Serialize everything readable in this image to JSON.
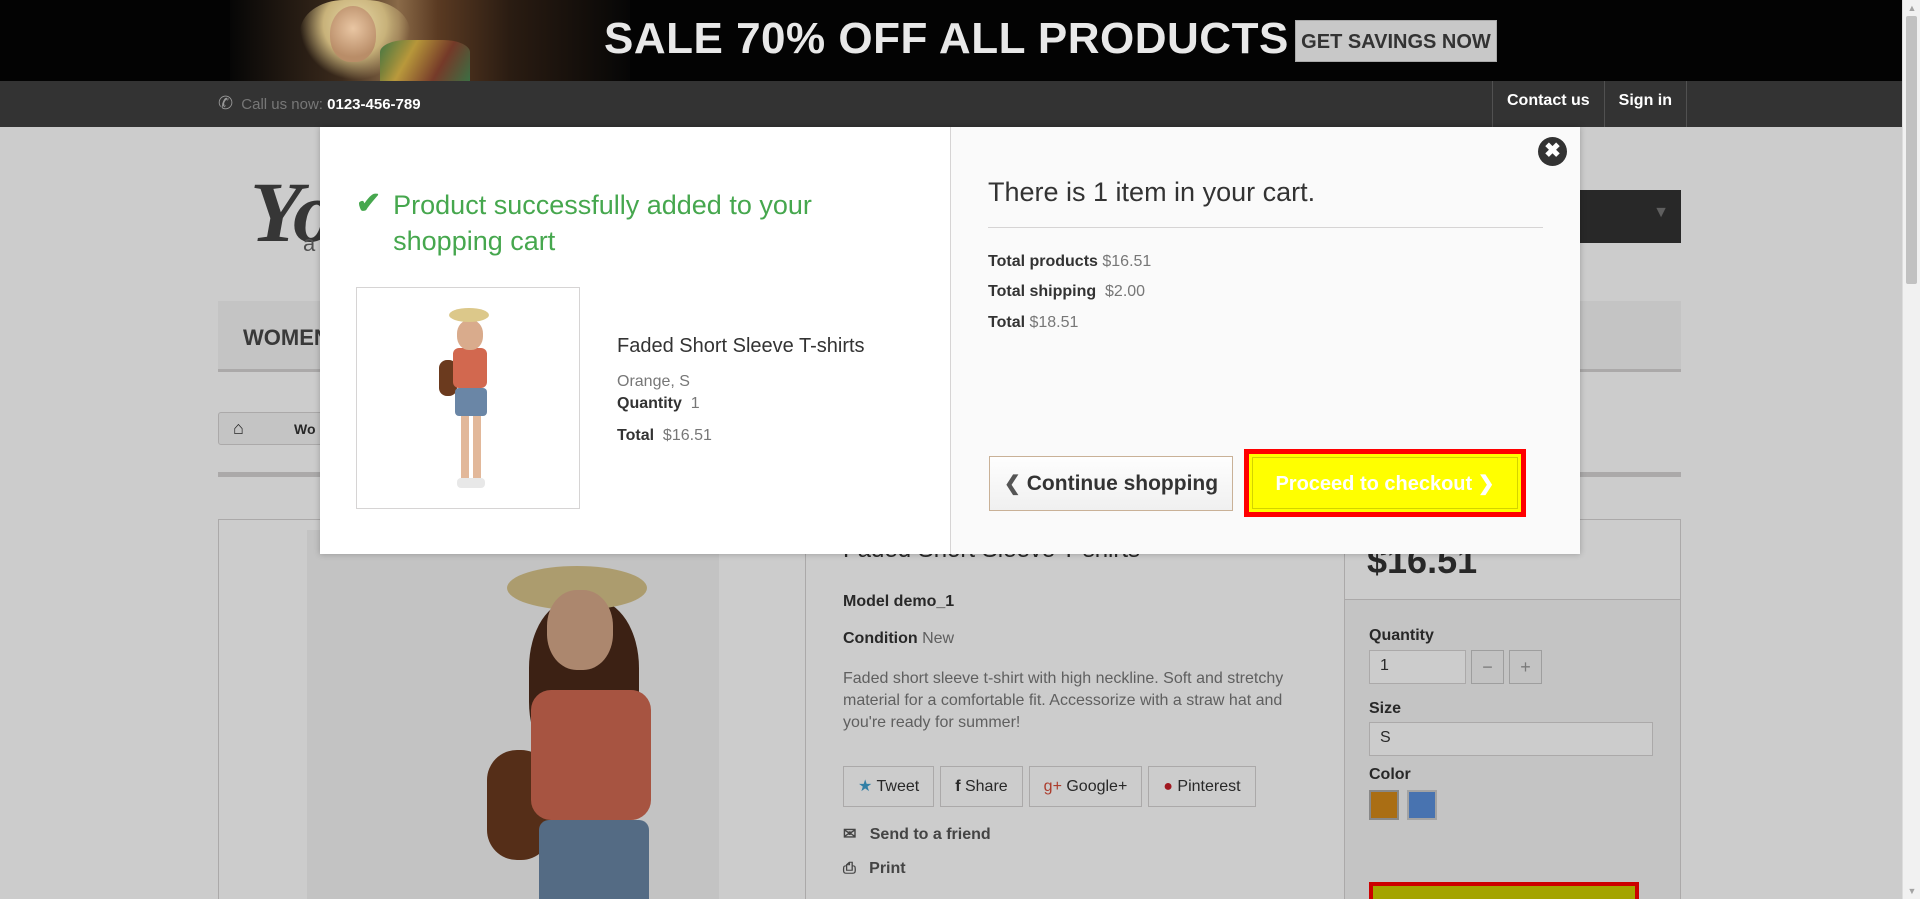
{
  "banner": {
    "headline": "SALE 70% OFF ALL PRODUCTS",
    "cta": "GET SAVINGS NOW"
  },
  "navbar": {
    "call_label": "Call us now:",
    "phone": "0123-456-789",
    "contact": "Contact us",
    "signin": "Sign in"
  },
  "page": {
    "logo_letters": "Yo",
    "logo_sub": "a",
    "menu_first": "WOMEN",
    "crumb_text": "Wo",
    "product_title": "Faded Short Sleeve T-shirts",
    "model_label": "Model demo_1",
    "condition_label": "Condition",
    "condition_value": "New",
    "description": "Faded short sleeve t-shirt with high neckline. Soft and stretchy material for a comfortable fit. Accessorize with a straw hat and you're ready for summer!",
    "share": {
      "tweet": "Tweet",
      "share": "Share",
      "google": "Google+",
      "pinterest": "Pinterest"
    },
    "send_friend": "Send to a friend",
    "print": "Print",
    "price": "$16.51",
    "quantity_label": "Quantity",
    "quantity_value": "1",
    "size_label": "Size",
    "size_value": "S",
    "color_label": "Color",
    "colors": [
      "#d58a1a",
      "#5a90dc"
    ]
  },
  "modal": {
    "success_message": "Product successfully added to your shopping cart",
    "product_name": "Faded Short Sleeve T-shirts",
    "attributes": "Orange, S",
    "quantity_label": "Quantity",
    "quantity_value": "1",
    "total_label": "Total",
    "total_value": "$16.51",
    "cart_title": "There is 1 item in your cart.",
    "total_products_label": "Total products",
    "total_products_value": "$16.51",
    "total_shipping_label": "Total shipping",
    "total_shipping_value": "$2.00",
    "grand_total_label": "Total",
    "grand_total_value": "$18.51",
    "continue_label": "Continue shopping",
    "checkout_label": "Proceed to checkout"
  },
  "colors": {
    "success_green": "#46a74e",
    "checkout_yellow": "#ffff00",
    "highlight_red": "#ff0000",
    "dark_bar": "#333333"
  }
}
